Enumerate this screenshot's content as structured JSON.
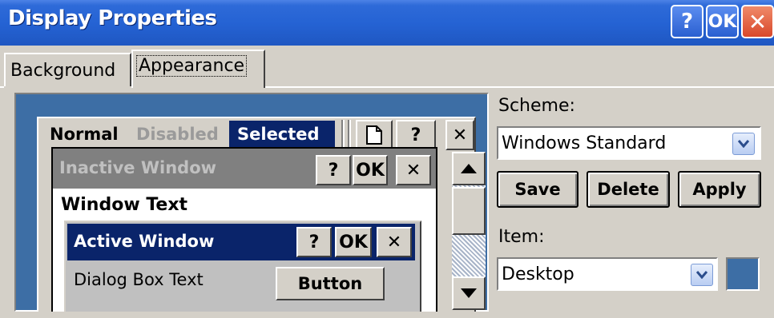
{
  "window": {
    "title": "Display Properties",
    "help_label": "?",
    "ok_label": "OK",
    "close_label": "✕"
  },
  "tabs": [
    {
      "label": "Background",
      "selected": false
    },
    {
      "label": "Appearance",
      "selected": true
    }
  ],
  "preview": {
    "menu": {
      "normal": "Normal",
      "disabled": "Disabled",
      "selected": "Selected",
      "help": "?",
      "close": "✕"
    },
    "inactive_window": {
      "title": "Inactive Window",
      "help": "?",
      "ok": "OK",
      "close": "✕"
    },
    "window_text": "Window Text",
    "active_window": {
      "title": "Active Window",
      "help": "?",
      "ok": "OK",
      "close": "✕"
    },
    "dialog_text": "Dialog Box Text",
    "button_label": "Button"
  },
  "scheme": {
    "label": "Scheme:",
    "value": "Windows Standard",
    "save_label": "Save",
    "delete_label": "Delete",
    "apply_label": "Apply"
  },
  "item": {
    "label": "Item:",
    "value": "Desktop",
    "color": "#3d6ea5"
  },
  "colors": {
    "titlebar": "#2563d4",
    "active_title": "#0a246a",
    "inactive_title": "#808080",
    "desktop": "#3d6ea5"
  }
}
